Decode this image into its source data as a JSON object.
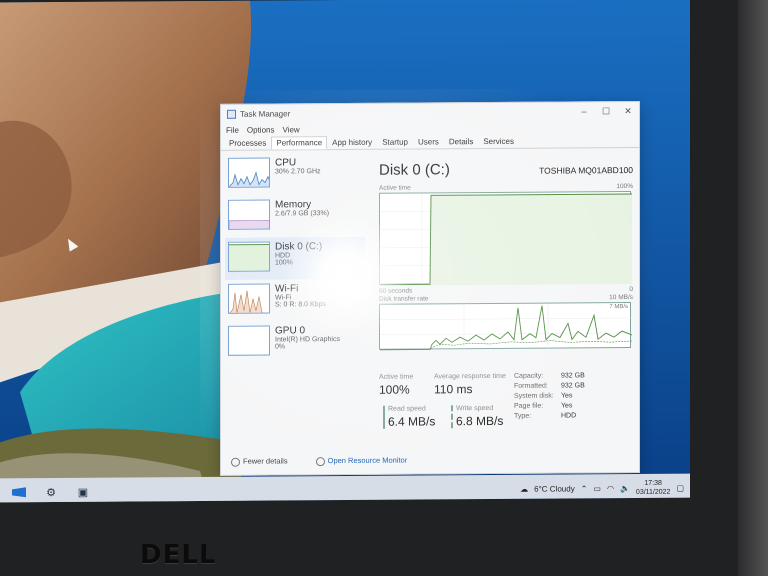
{
  "window": {
    "title": "Task Manager",
    "controls": [
      "–",
      "☐",
      "✕"
    ]
  },
  "menu": [
    "File",
    "Options",
    "View"
  ],
  "tabs": [
    "Processes",
    "Performance",
    "App history",
    "Startup",
    "Users",
    "Details",
    "Services"
  ],
  "active_tab": "Performance",
  "sidebar": [
    {
      "name": "CPU",
      "line2": "30% 2.70 GHz",
      "line3": ""
    },
    {
      "name": "Memory",
      "line2": "2.6/7.9 GB (33%)",
      "line3": ""
    },
    {
      "name": "Disk 0 (C:)",
      "line2": "HDD",
      "line3": "100%"
    },
    {
      "name": "Wi-Fi",
      "line2": "Wi-Fi",
      "line3": "S: 0 R: 8.0 Kbps"
    },
    {
      "name": "GPU 0",
      "line2": "Intel(R) HD Graphics",
      "line3": "0%"
    }
  ],
  "main": {
    "title": "Disk 0 (C:)",
    "model": "TOSHIBA MQ01ABD100",
    "graph1_label": "Active time",
    "graph1_max": "100%",
    "graph1_min": "0",
    "graph2_label": "Disk transfer rate",
    "graph2_max": "10 MB/s",
    "graph2_sub": "7 MB/s",
    "graph2_min": "0",
    "duration": "60 seconds"
  },
  "stats": {
    "active_time_label": "Active time",
    "active_time_value": "100%",
    "response_label": "Average response time",
    "response_value": "110 ms",
    "read_label": "Read speed",
    "read_value": "6.4 MB/s",
    "write_label": "Write speed",
    "write_value": "6.8 MB/s"
  },
  "properties": [
    {
      "key": "Capacity:",
      "value": "932 GB"
    },
    {
      "key": "Formatted:",
      "value": "932 GB"
    },
    {
      "key": "System disk:",
      "value": "Yes"
    },
    {
      "key": "Page file:",
      "value": "Yes"
    },
    {
      "key": "Type:",
      "value": "HDD"
    }
  ],
  "footer": {
    "fewer_details": "Fewer details",
    "open_monitor": "Open Resource Monitor"
  },
  "taskbar": {
    "weather": "6°C Cloudy",
    "time": "17:38",
    "date": "03/11/2022"
  },
  "bezel_brand": "DELL",
  "colors": {
    "graph_line": "#4a8a3c",
    "graph_border": "#7fa39a",
    "cpu_graph": "#3a78c2",
    "link": "#1a62b8"
  }
}
